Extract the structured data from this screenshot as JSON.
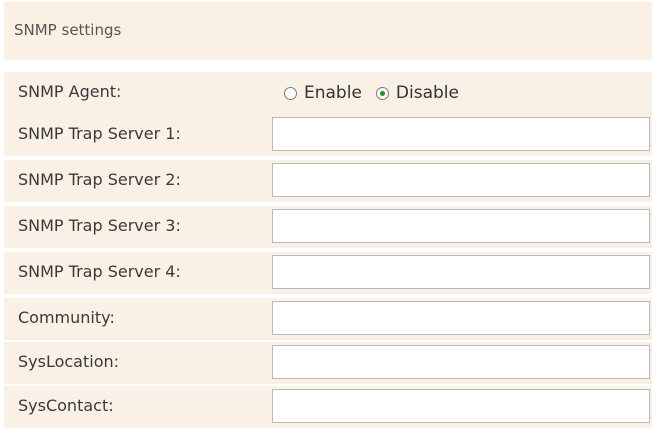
{
  "section": {
    "title": "SNMP settings"
  },
  "snmp_agent": {
    "label": "SNMP Agent:",
    "options": [
      "Enable",
      "Disable"
    ],
    "selected": "Disable"
  },
  "fields": [
    {
      "label": "SNMP Trap Server 1:",
      "value": ""
    },
    {
      "label": "SNMP Trap Server 2:",
      "value": ""
    },
    {
      "label": "SNMP Trap Server 3:",
      "value": ""
    },
    {
      "label": "SNMP Trap Server 4:",
      "value": ""
    },
    {
      "label": "Community:",
      "value": ""
    },
    {
      "label": "SysLocation:",
      "value": ""
    },
    {
      "label": "SysContact:",
      "value": ""
    }
  ]
}
